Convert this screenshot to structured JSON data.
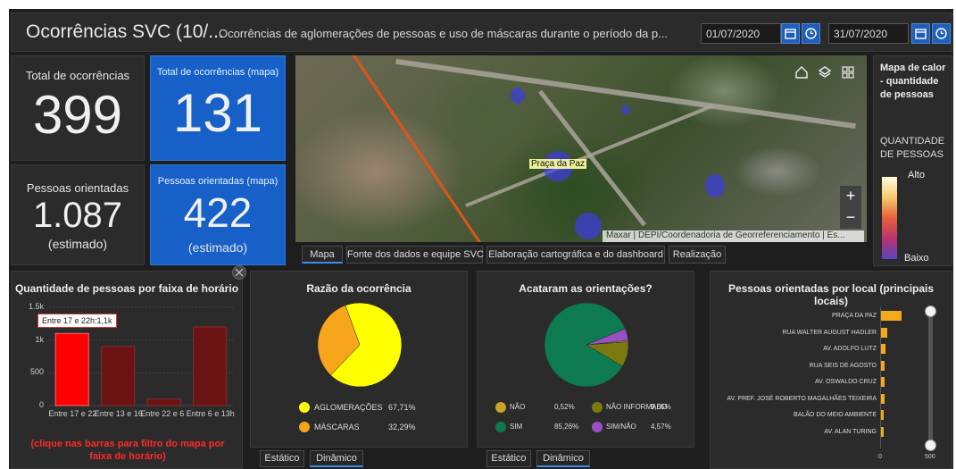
{
  "header": {
    "title": "Ocorrências SVC (10/...",
    "subtitle": "Ocorrências de aglomerações de pessoas e uso de máscaras durante o período da p...",
    "start_date": "01/07/2020",
    "end_date": "31/07/2020"
  },
  "indicators": {
    "total": {
      "title": "Total de ocorrências",
      "value": "399"
    },
    "total_map": {
      "title": "Total de ocorrências (mapa)",
      "value": "131"
    },
    "people": {
      "title": "Pessoas orientadas",
      "value": "1.087",
      "footer": "(estimado)"
    },
    "people_map": {
      "title": "Pessoas orientadas (mapa)",
      "value": "422",
      "footer": "(estimado)"
    }
  },
  "map": {
    "place_label": "Praça da Paz",
    "attribution": "Maxar | DEPI/Coordenadoria de Georreferenciamento | Es...",
    "zoom_in": "+",
    "zoom_out": "−",
    "tabs": [
      "Mapa",
      "Fonte dos dados e equipe SVC",
      "Elaboração cartográfica e do dashboard",
      "Realização"
    ]
  },
  "legend": {
    "title": "Mapa de calor - quantidade de pessoas",
    "field": "QUANTIDADE DE PESSOAS",
    "high": "Alto",
    "low": "Baixo"
  },
  "bottom_tabs": {
    "static": "Estático",
    "dynamic": "Dinâmico"
  },
  "chart_data": [
    {
      "type": "bar",
      "title": "Quantidade de pessoas por faixa de horário",
      "categories": [
        "Entre 17 e 22h",
        "Entre 13 e 16h",
        "Entre 22 e 6h",
        "Entre 6 e 13h"
      ],
      "tick_labels": [
        "Entre 17 e 22",
        "Entre 13 e 16",
        "Entre 22 e 6",
        "Entre 6 e 13h"
      ],
      "values": [
        1100,
        900,
        100,
        1200
      ],
      "ylim": [
        0,
        1500
      ],
      "yticks": [
        "0",
        "500",
        "1k",
        "1.5k"
      ],
      "tooltip": "Entre 17 e 22h:1,1k",
      "note": "(clique nas barras para filtro do mapa por faixa de horário)",
      "colors": [
        "#ff0000",
        "#6a1414",
        "#6a1414",
        "#6a1414"
      ]
    },
    {
      "type": "pie",
      "title": "Razão da ocorrência",
      "categories": [
        "AGLOMERAÇÕES",
        "MÁSCARAS"
      ],
      "values": [
        67.71,
        32.29
      ],
      "labels": [
        "67,71%",
        "32,29%"
      ],
      "colors": [
        "#ffff00",
        "#f7a51b"
      ]
    },
    {
      "type": "pie",
      "title": "Acataram as orientações?",
      "categories": [
        "NÃO",
        "NÃO INFORMADO",
        "SIM",
        "SIM/NÃO"
      ],
      "values": [
        0.52,
        9.65,
        85.26,
        4.57
      ],
      "labels": [
        "0,52%",
        "9,65%",
        "85,26%",
        "4,57%"
      ],
      "colors": [
        "#c9a227",
        "#7a7a10",
        "#0e7a52",
        "#9b4fc4"
      ]
    },
    {
      "type": "bar",
      "orientation": "horizontal",
      "title": "Pessoas orientadas por local (principais locais)",
      "categories": [
        "PRAÇA DA PAZ",
        "RUA WALTER AUGUST HADLER",
        "AV. ADOLFO LUTZ",
        "RUA SEIS DE AGOSTO",
        "AV. OSWALDO CRUZ",
        "AV. PREF. JOSÉ ROBERTO MAGALHÃES TEIXEIRA",
        "BALÃO DO MEIO AMBIENTE",
        "AV. ALAN TURING"
      ],
      "values": [
        140,
        48,
        38,
        32,
        30,
        28,
        26,
        24
      ],
      "xlim": [
        0,
        500
      ],
      "xticks": [
        "0",
        "500"
      ],
      "color": "#f6a81b"
    }
  ]
}
